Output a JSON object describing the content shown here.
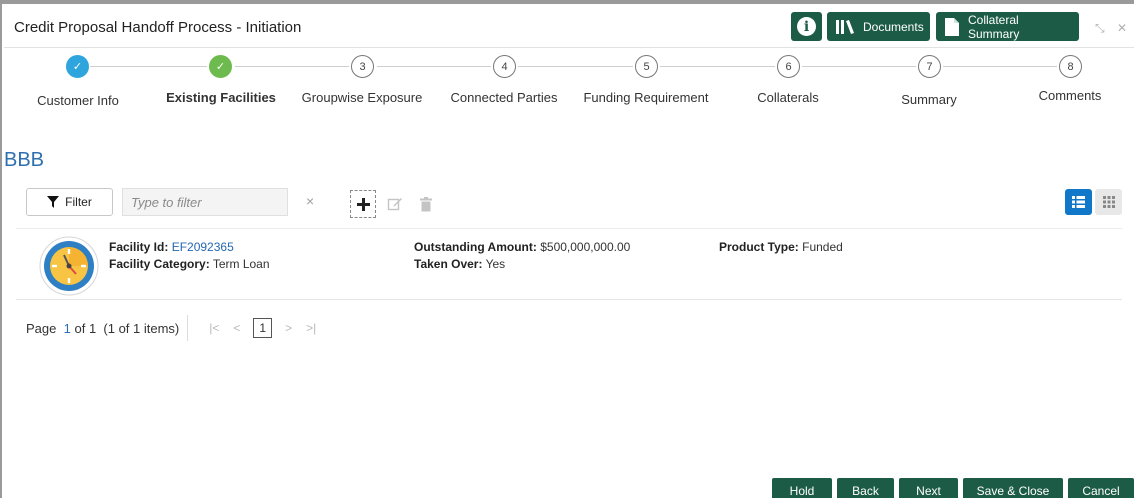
{
  "header": {
    "title": "Credit Proposal Handoff Process - Initiation",
    "documents_label": "Documents",
    "collateral_summary_label": "Collateral Summary"
  },
  "stepper": {
    "steps": [
      {
        "number": "1",
        "label": "Customer Info",
        "status": "completed",
        "color": "#2fa5dd"
      },
      {
        "number": "2",
        "label": "Existing Facilities",
        "status": "current",
        "color": "#6dbb4e"
      },
      {
        "number": "3",
        "label": "Groupwise Exposure",
        "status": "pending"
      },
      {
        "number": "4",
        "label": "Connected Parties",
        "status": "pending"
      },
      {
        "number": "5",
        "label": "Funding Requirement",
        "status": "pending"
      },
      {
        "number": "6",
        "label": "Collaterals",
        "status": "pending"
      },
      {
        "number": "7",
        "label": "Summary",
        "status": "pending"
      },
      {
        "number": "8",
        "label": "Comments",
        "status": "pending"
      }
    ]
  },
  "section": {
    "title": "BBB"
  },
  "toolbar": {
    "filter_label": "Filter",
    "filter_placeholder": "Type to filter",
    "clear_symbol": "×"
  },
  "records": [
    {
      "facility_id_label": "Facility Id:",
      "facility_id": "EF2092365",
      "facility_category_label": "Facility Category:",
      "facility_category": "Term Loan",
      "outstanding_amount_label": "Outstanding Amount:",
      "outstanding_amount": "$500,000,000.00",
      "taken_over_label": "Taken Over:",
      "taken_over": "Yes",
      "product_type_label": "Product Type:",
      "product_type": "Funded"
    }
  ],
  "pagination": {
    "page_label": "Page",
    "current_page": "1",
    "of_label": "of",
    "total_pages": "1",
    "items_summary": "(1 of 1 items)",
    "page_box": "1"
  },
  "footer": {
    "hold_label": "Hold",
    "back_label": "Back",
    "next_label": "Next",
    "save_close_label": "Save & Close",
    "cancel_label": "Cancel"
  },
  "colors": {
    "brand_green": "#1c5c46",
    "accent_blue": "#1178c9",
    "link_blue": "#2468b0"
  }
}
